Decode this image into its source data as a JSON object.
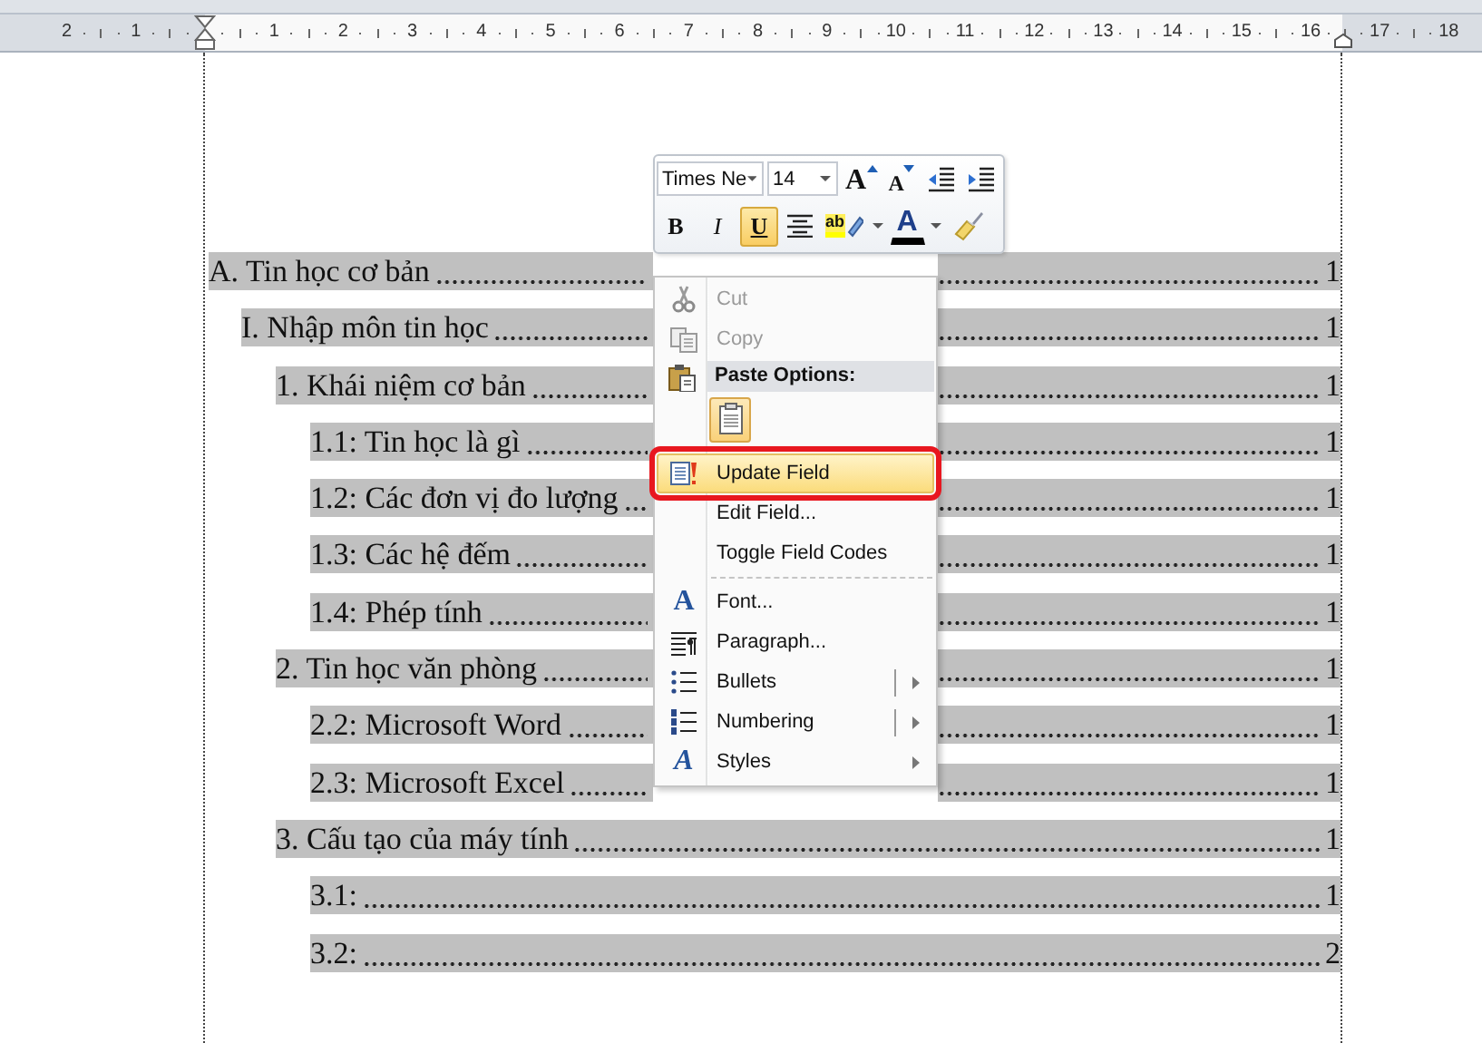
{
  "ruler": {
    "left_numbers": [
      "2",
      "1"
    ],
    "numbers": [
      "1",
      "2",
      "3",
      "4",
      "5",
      "6",
      "7",
      "8",
      "9",
      "10",
      "11",
      "12",
      "13",
      "14",
      "15",
      "16",
      "17",
      "18"
    ]
  },
  "toc": [
    {
      "title": "A. Tin học cơ bản",
      "page": "1",
      "children": [
        {
          "title": "I. Nhập môn tin học",
          "page": "1",
          "children": [
            {
              "title": "1. Khái niệm cơ bản",
              "page": "1",
              "children": [
                {
                  "title": "1.1: Tin học là gì",
                  "page": "1"
                },
                {
                  "title": "1.2: Các đơn vị đo lượng",
                  "page": "1"
                },
                {
                  "title": "1.3: Các hệ đếm",
                  "page": "1"
                },
                {
                  "title": "1.4: Phép tính",
                  "page": "1"
                }
              ]
            },
            {
              "title": "2. Tin học văn phòng",
              "page": "1",
              "children": [
                {
                  "title": "2.2: Microsoft Word",
                  "page": "1"
                },
                {
                  "title": "2.3: Microsoft Excel",
                  "page": "1"
                }
              ]
            },
            {
              "title": "3. Cấu tạo của máy tính",
              "page": "1",
              "children": [
                {
                  "title": "3.1:",
                  "page": "1"
                },
                {
                  "title": "3.2:",
                  "page": "2"
                }
              ]
            }
          ]
        }
      ]
    }
  ],
  "mini_toolbar": {
    "row_1": [
      {
        "kind": "font",
        "value": "Times Ne"
      },
      {
        "kind": "size",
        "value": "14"
      },
      {
        "kind": "grow",
        "label": "A"
      },
      {
        "kind": "shrink",
        "label": "A"
      },
      {
        "kind": "outdent"
      },
      {
        "kind": "indent"
      }
    ],
    "row_2": [
      {
        "kind": "toggle",
        "label": "B",
        "selected": false
      },
      {
        "kind": "toggle",
        "label": "I",
        "selected": false
      },
      {
        "kind": "toggle",
        "label": "U",
        "selected": true
      },
      {
        "kind": "center"
      },
      {
        "kind": "highlight",
        "label": "ab"
      },
      {
        "kind": "font-color",
        "label": "A"
      },
      {
        "kind": "painter"
      }
    ]
  },
  "context_menu": {
    "items": [
      {
        "kind": "command",
        "label": "Cut",
        "disabled": true,
        "selected": false,
        "marked": false,
        "submenu": false,
        "split": false
      },
      {
        "kind": "command",
        "label": "Copy",
        "disabled": true,
        "selected": false,
        "marked": false,
        "submenu": false,
        "split": false
      },
      {
        "kind": "header",
        "label": "Paste Options:"
      },
      {
        "kind": "paste-options"
      },
      {
        "kind": "separator"
      },
      {
        "kind": "command",
        "label": "Update Field",
        "disabled": false,
        "selected": true,
        "marked": true,
        "submenu": false,
        "split": false
      },
      {
        "kind": "command",
        "label": "Edit Field...",
        "disabled": false,
        "selected": false,
        "marked": false,
        "submenu": false,
        "split": false
      },
      {
        "kind": "command",
        "label": "Toggle Field Codes",
        "disabled": false,
        "selected": false,
        "marked": false,
        "submenu": false,
        "split": false
      },
      {
        "kind": "separator"
      },
      {
        "kind": "command",
        "label": "Font...",
        "glyph": "A",
        "disabled": false,
        "selected": false,
        "marked": false,
        "submenu": false,
        "split": false
      },
      {
        "kind": "command",
        "label": "Paragraph...",
        "disabled": false,
        "selected": false,
        "marked": false,
        "submenu": false,
        "split": false
      },
      {
        "kind": "command",
        "label": "Bullets",
        "disabled": false,
        "selected": false,
        "marked": false,
        "submenu": true,
        "split": true
      },
      {
        "kind": "command",
        "label": "Numbering",
        "disabled": false,
        "selected": false,
        "marked": false,
        "submenu": true,
        "split": true
      },
      {
        "kind": "command",
        "label": "Styles",
        "glyph": "A",
        "disabled": false,
        "selected": false,
        "marked": false,
        "submenu": true,
        "split": false
      }
    ]
  }
}
